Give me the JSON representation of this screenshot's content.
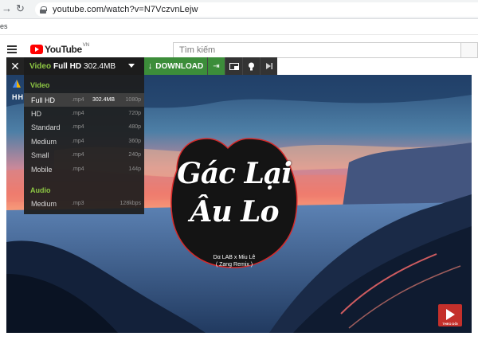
{
  "browser": {
    "url": "youtube.com/watch?v=N7VczvnLejw",
    "bookmark_text": "es"
  },
  "header": {
    "logo_text": "YouTube",
    "logo_region": "VN",
    "search_placeholder": "Tìm kiếm"
  },
  "downloader": {
    "close_label": "✕",
    "selected": {
      "kind": "Video",
      "quality": "Full HD",
      "size": "302.4MB"
    },
    "download_label": "DOWNLOAD",
    "menu": {
      "video_group_label": "Video",
      "video_items": [
        {
          "name": "Full HD",
          "ext": ".mp4",
          "size": "302.4MB",
          "res": "1080p",
          "active": true
        },
        {
          "name": "HD",
          "ext": ".mp4",
          "size": "",
          "res": "720p"
        },
        {
          "name": "Standard",
          "ext": ".mp4",
          "size": "",
          "res": "480p"
        },
        {
          "name": "Medium",
          "ext": ".mp4",
          "size": "",
          "res": "360p"
        },
        {
          "name": "Small",
          "ext": ".mp4",
          "size": "",
          "res": "240p"
        },
        {
          "name": "Mobile",
          "ext": ".mp4",
          "size": "",
          "res": "144p"
        }
      ],
      "audio_group_label": "Audio",
      "audio_items": [
        {
          "name": "Medium",
          "ext": ".mp3",
          "size": "",
          "res": "128kbps"
        }
      ]
    }
  },
  "video": {
    "side_letters": "HH",
    "cover_title_line1": "Gác Lại",
    "cover_title_line2": "Âu Lo",
    "cover_artist": "Dα LAB x Miu Lê",
    "cover_remix": "( Zang Remix )",
    "subscribe_label": "THEO DÕI"
  },
  "colors": {
    "download_green": "#3c8d3a",
    "menu_group_green": "#8dc643",
    "youtube_red": "#ff0000"
  }
}
